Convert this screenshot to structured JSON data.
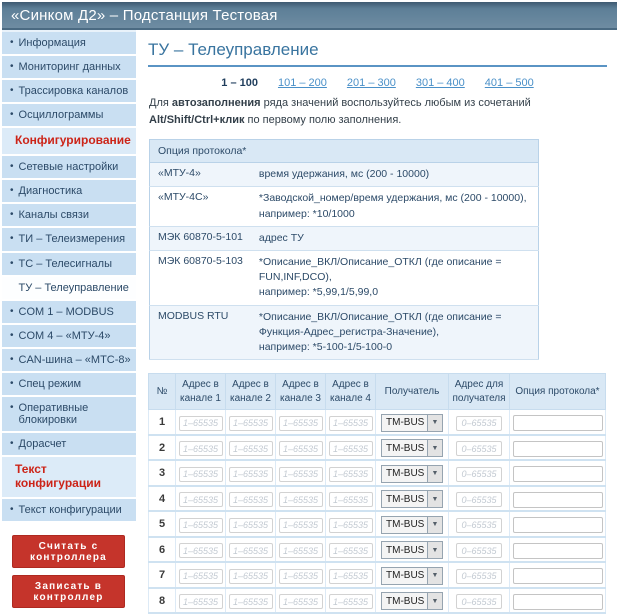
{
  "header": {
    "title": "«Синком Д2» – Подстанция Тестовая"
  },
  "colors": {
    "header_bar": "#6e8ca2",
    "sidebar_item_bg": "#c9dff2",
    "sidebar_section_bg": "#dcebf8",
    "section_red_text": "#cc2418",
    "button_red": "#c5342b",
    "link_blue": "#4a90c8",
    "title_blue": "#39749f",
    "table_header_bg": "#d9e8f5",
    "table_border": "#b9d2e8"
  },
  "sidebar": {
    "items": [
      {
        "type": "link",
        "label": "Информация"
      },
      {
        "type": "link",
        "label": "Мониторинг данных"
      },
      {
        "type": "link",
        "label": "Трассировка каналов"
      },
      {
        "type": "link",
        "label": "Осциллограммы"
      },
      {
        "type": "section",
        "label": "Конфигурирование"
      },
      {
        "type": "link",
        "label": "Сетевые настройки"
      },
      {
        "type": "link",
        "label": "Диагностика"
      },
      {
        "type": "link",
        "label": "Каналы связи"
      },
      {
        "type": "link",
        "label": "ТИ – Телеизмерения"
      },
      {
        "type": "link",
        "label": "ТС – Телесигналы"
      },
      {
        "type": "selected",
        "label": "ТУ – Телеуправление"
      },
      {
        "type": "link",
        "label": "COM 1 – MODBUS"
      },
      {
        "type": "link",
        "label": "COM 4 – «МТУ-4»"
      },
      {
        "type": "link",
        "label": "CAN-шина – «МТС-8»"
      },
      {
        "type": "link",
        "label": "Спец режим"
      },
      {
        "type": "link",
        "label": "Оперативные блокировки"
      },
      {
        "type": "link",
        "label": "Дорасчет"
      },
      {
        "type": "section",
        "label": "Текст конфигурации"
      },
      {
        "type": "link",
        "label": "Текст конфигурации"
      }
    ],
    "buttons": [
      {
        "id": "read-from-controller",
        "label": "Считать с контроллера"
      },
      {
        "id": "write-to-controller",
        "label": "Записать в контроллер"
      }
    ]
  },
  "main": {
    "title": "ТУ – Телеуправление",
    "pagination": [
      {
        "label": "1 – 100",
        "current": true
      },
      {
        "label": "101 – 200",
        "current": false
      },
      {
        "label": "201 – 300",
        "current": false
      },
      {
        "label": "301 – 400",
        "current": false
      },
      {
        "label": "401 – 500",
        "current": false
      }
    ],
    "hint_segments": [
      {
        "text": "Для ",
        "bold": false
      },
      {
        "text": "автозаполнения",
        "bold": true
      },
      {
        "text": " ряда значений воспользуйтесь любым из сочетаний ",
        "bold": false
      },
      {
        "text": "Alt/Shift/Ctrl+клик",
        "bold": true
      },
      {
        "text": " по первому полю заполнения.",
        "bold": false
      }
    ],
    "protocol_table": {
      "header": "Опция протокола*",
      "rows": [
        {
          "name": "«МТУ-4»",
          "lines": [
            "время удержания, мс (200 - 10000)"
          ]
        },
        {
          "name": "«МТУ-4С»",
          "lines": [
            "*Заводской_номер/время удержания, мс (200 - 10000),",
            "например: *10/1000"
          ]
        },
        {
          "name": "МЭК 60870-5-101",
          "lines": [
            "адрес ТУ"
          ]
        },
        {
          "name": "МЭК 60870-5-103",
          "lines": [
            "*Описание_ВКЛ/Описание_ОТКЛ (где описание = FUN,INF,DCO),",
            "например: *5,99,1/5,99,0"
          ]
        },
        {
          "name": "MODBUS RTU",
          "lines": [
            "*Описание_ВКЛ/Описание_ОТКЛ (где описание = Функция-Адрес_регистра-Значение),",
            "например: *5-100-1/5-100-0"
          ]
        }
      ]
    },
    "data_table": {
      "columns": [
        "№",
        "Адрес в канале 1",
        "Адрес в канале 2",
        "Адрес в канале 3",
        "Адрес в канале 4",
        "Получатель",
        "Адрес для получателя",
        "Опция протокола*"
      ],
      "address_placeholder": "1–65535",
      "recipient_value": "TM-BUS",
      "recipient_addr_placeholder": "0–65535",
      "rows": [
        {
          "num": "1"
        },
        {
          "num": "2"
        },
        {
          "num": "3"
        },
        {
          "num": "4"
        },
        {
          "num": "5"
        },
        {
          "num": "6"
        },
        {
          "num": "7"
        },
        {
          "num": "8"
        }
      ]
    }
  }
}
